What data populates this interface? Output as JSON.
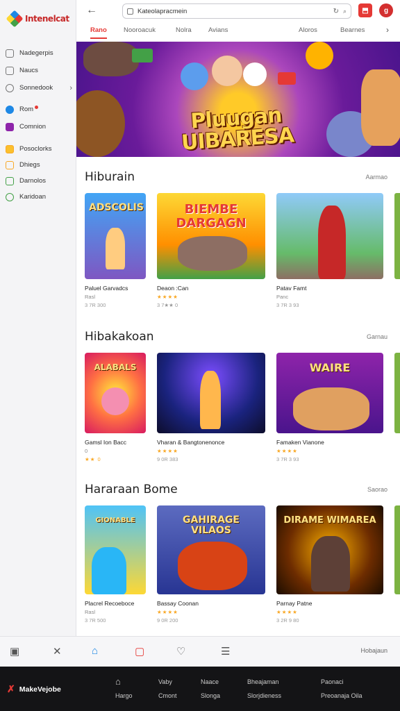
{
  "app": {
    "logo_text": "Intenelcat"
  },
  "sidebar": {
    "items": [
      {
        "label": "Nadegerpis",
        "icon": "home-icon",
        "color": "#777777"
      },
      {
        "label": "Naucs",
        "icon": "grid-icon",
        "color": "#777777"
      },
      {
        "label": "Sonnedook",
        "icon": "settings-icon",
        "color": "#777777",
        "chevron": "›"
      },
      {
        "label": "Rom",
        "icon": "cloud-icon",
        "color": "#1e88e5"
      },
      {
        "label": "Comnion",
        "icon": "chat-icon",
        "color": "#8e24aa"
      },
      {
        "label": "Posoclorks",
        "icon": "folder-icon",
        "color": "#f9a825"
      },
      {
        "label": "Dhiegs",
        "icon": "bookmark-icon",
        "color": "#f9a825"
      },
      {
        "label": "Darnolos",
        "icon": "doc-icon",
        "color": "#43a047"
      },
      {
        "label": "Karidoan",
        "icon": "globe-icon",
        "color": "#43a047"
      }
    ]
  },
  "topbar": {
    "back": "←",
    "search_value": "Kateolapracmein",
    "reload": "↻",
    "mic": "⌕"
  },
  "tabs": [
    {
      "label": "Rano",
      "active": true
    },
    {
      "label": "Nooroacuk"
    },
    {
      "label": "Nolra"
    },
    {
      "label": "Avians"
    },
    {
      "label": "Aloros"
    },
    {
      "label": "Bearnes"
    }
  ],
  "tabs_chevron": "›",
  "hero": {
    "title": "Pluugan",
    "title_line2": "UIBARESA"
  },
  "sections": [
    {
      "title": "Hiburain",
      "more": "Aarmao",
      "cards": [
        {
          "thumb_text": "ADSCOLIS",
          "title": "Paluel Garvadcs",
          "sub": "Rasl",
          "rating": "",
          "meta": "3 7R 300"
        },
        {
          "thumb_text": "BIEMBE DARGAGN",
          "title": "Deaon :Can",
          "sub": "",
          "rating": "★★★★",
          "meta": "3 7★★ 0"
        },
        {
          "thumb_text": "",
          "title": "Patav Famt",
          "sub": "Panc",
          "rating": "",
          "meta": "3 7R 3 93"
        }
      ]
    },
    {
      "title": "Hibakakoan",
      "more": "Garnau",
      "cards": [
        {
          "thumb_text": "ALABALS",
          "title": "Gamsl Ion Bacc",
          "sub": "0",
          "rating": "★★ 0",
          "meta": ""
        },
        {
          "thumb_text": "",
          "title": "Vharan & Bangtonenonce",
          "sub": "",
          "rating": "★★★★",
          "meta": "9 0R 383"
        },
        {
          "thumb_text": "WAIRE",
          "title": "Famaken Vianone",
          "sub": "",
          "rating": "★★★★",
          "meta": "3 7R 3 93"
        }
      ]
    },
    {
      "title": "Hararaan Bome",
      "more": "Saorao",
      "cards": [
        {
          "thumb_text": "GIONABLE",
          "title": "Placrel Recoeboce",
          "sub": "Rasl",
          "rating": "",
          "meta": "3 7R 500"
        },
        {
          "thumb_text": "GAHIRAGE VILAOS",
          "title": "Bassay Coonan",
          "sub": "",
          "rating": "★★★★",
          "meta": "9 0R 200"
        },
        {
          "thumb_text": "DIRAME WIMAREA",
          "title": "Parnay Patne",
          "sub": "",
          "rating": "★★★★",
          "meta": "3 2R 9 80"
        }
      ]
    }
  ],
  "bottom_tools": {
    "icons": [
      "panel-icon",
      "tools-icon",
      "share-icon",
      "bookmark-icon",
      "heart-icon",
      "notes-icon"
    ],
    "right_label": "Hobajaun"
  },
  "footer": {
    "logo": "MakeVejobe",
    "columns": [
      {
        "line1": "",
        "line2": "Hargo"
      },
      {
        "line1": "Vaby",
        "line2": "Cmont"
      },
      {
        "line1": "Naace",
        "line2": "Slonga"
      },
      {
        "line1": "Bheajaman",
        "line2": "Slorjdieness"
      },
      {
        "line1": "Paonaci",
        "line2": "Preoanaja Oila"
      }
    ]
  },
  "colors": {
    "accent": "#e53935",
    "star": "#f9a825",
    "footer_bg": "#141416"
  }
}
